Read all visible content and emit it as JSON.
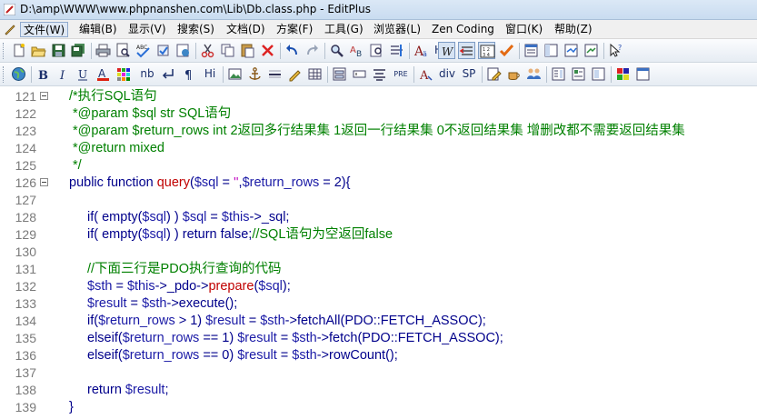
{
  "window": {
    "title": "D:\\amp\\WWW\\www.phpnanshen.com\\Lib\\Db.class.php - EditPlus"
  },
  "menu": [
    "文件(W)",
    "编辑(B)",
    "显示(V)",
    "搜索(S)",
    "文档(D)",
    "方案(F)",
    "工具(G)",
    "浏览器(L)",
    "Zen Coding",
    "窗口(K)",
    "帮助(Z)"
  ],
  "toolbar2_text": {
    "font_size_label": "Hx",
    "nb": "nb",
    "hi": "Hi",
    "pre": "PRE",
    "div": "div",
    "sp": "SP"
  },
  "editor": {
    "lines": [
      {
        "num": "121",
        "fold": true
      },
      {
        "num": "122"
      },
      {
        "num": "123"
      },
      {
        "num": "124"
      },
      {
        "num": "125"
      },
      {
        "num": "126",
        "fold": true
      },
      {
        "num": "127"
      },
      {
        "num": "128"
      },
      {
        "num": "129"
      },
      {
        "num": "130"
      },
      {
        "num": "131"
      },
      {
        "num": "132"
      },
      {
        "num": "133"
      },
      {
        "num": "134"
      },
      {
        "num": "135"
      },
      {
        "num": "136"
      },
      {
        "num": "137"
      },
      {
        "num": "138"
      },
      {
        "num": "139"
      }
    ],
    "code": {
      "l121": "/*执行SQL语句",
      "l122": " *@param $sql str SQL语句",
      "l123": " *@param $return_rows int 2返回多行结果集 1返回一行结果集 0不返回结果集 增删改都不需要返回结果集",
      "l124": " *@return mixed",
      "l125": " */",
      "l126": [
        "public function ",
        "query",
        "(",
        "$sql",
        " = ",
        "''",
        ",",
        "$return_rows",
        " = 2){"
      ],
      "l128": [
        "if( empty(",
        "$sql",
        ") ) ",
        "$sql",
        " = ",
        "$this",
        "->_sql;"
      ],
      "l129": [
        "if( empty(",
        "$sql",
        ") ) return false;",
        "//SQL语句为空返回false"
      ],
      "l131": "//下面三行是PDO执行查询的代码",
      "l132": [
        "$sth",
        " = ",
        "$this",
        "->_pdo->",
        "prepare",
        "(",
        "$sql",
        ");"
      ],
      "l133": [
        "$result",
        " = ",
        "$sth",
        "->execute();"
      ],
      "l134": [
        "if(",
        "$return_rows",
        " > 1) ",
        "$result",
        " = ",
        "$sth",
        "->fetchAll(PDO::FETCH_ASSOC);"
      ],
      "l135": [
        "elseif(",
        "$return_rows",
        " == 1) ",
        "$result",
        " = ",
        "$sth",
        "->fetch(PDO::FETCH_ASSOC);"
      ],
      "l136": [
        "elseif(",
        "$return_rows",
        " == 0) ",
        "$result",
        " = ",
        "$sth",
        "->rowCount();"
      ],
      "l138": [
        "return ",
        "$result",
        ";"
      ],
      "l139": "}"
    }
  }
}
